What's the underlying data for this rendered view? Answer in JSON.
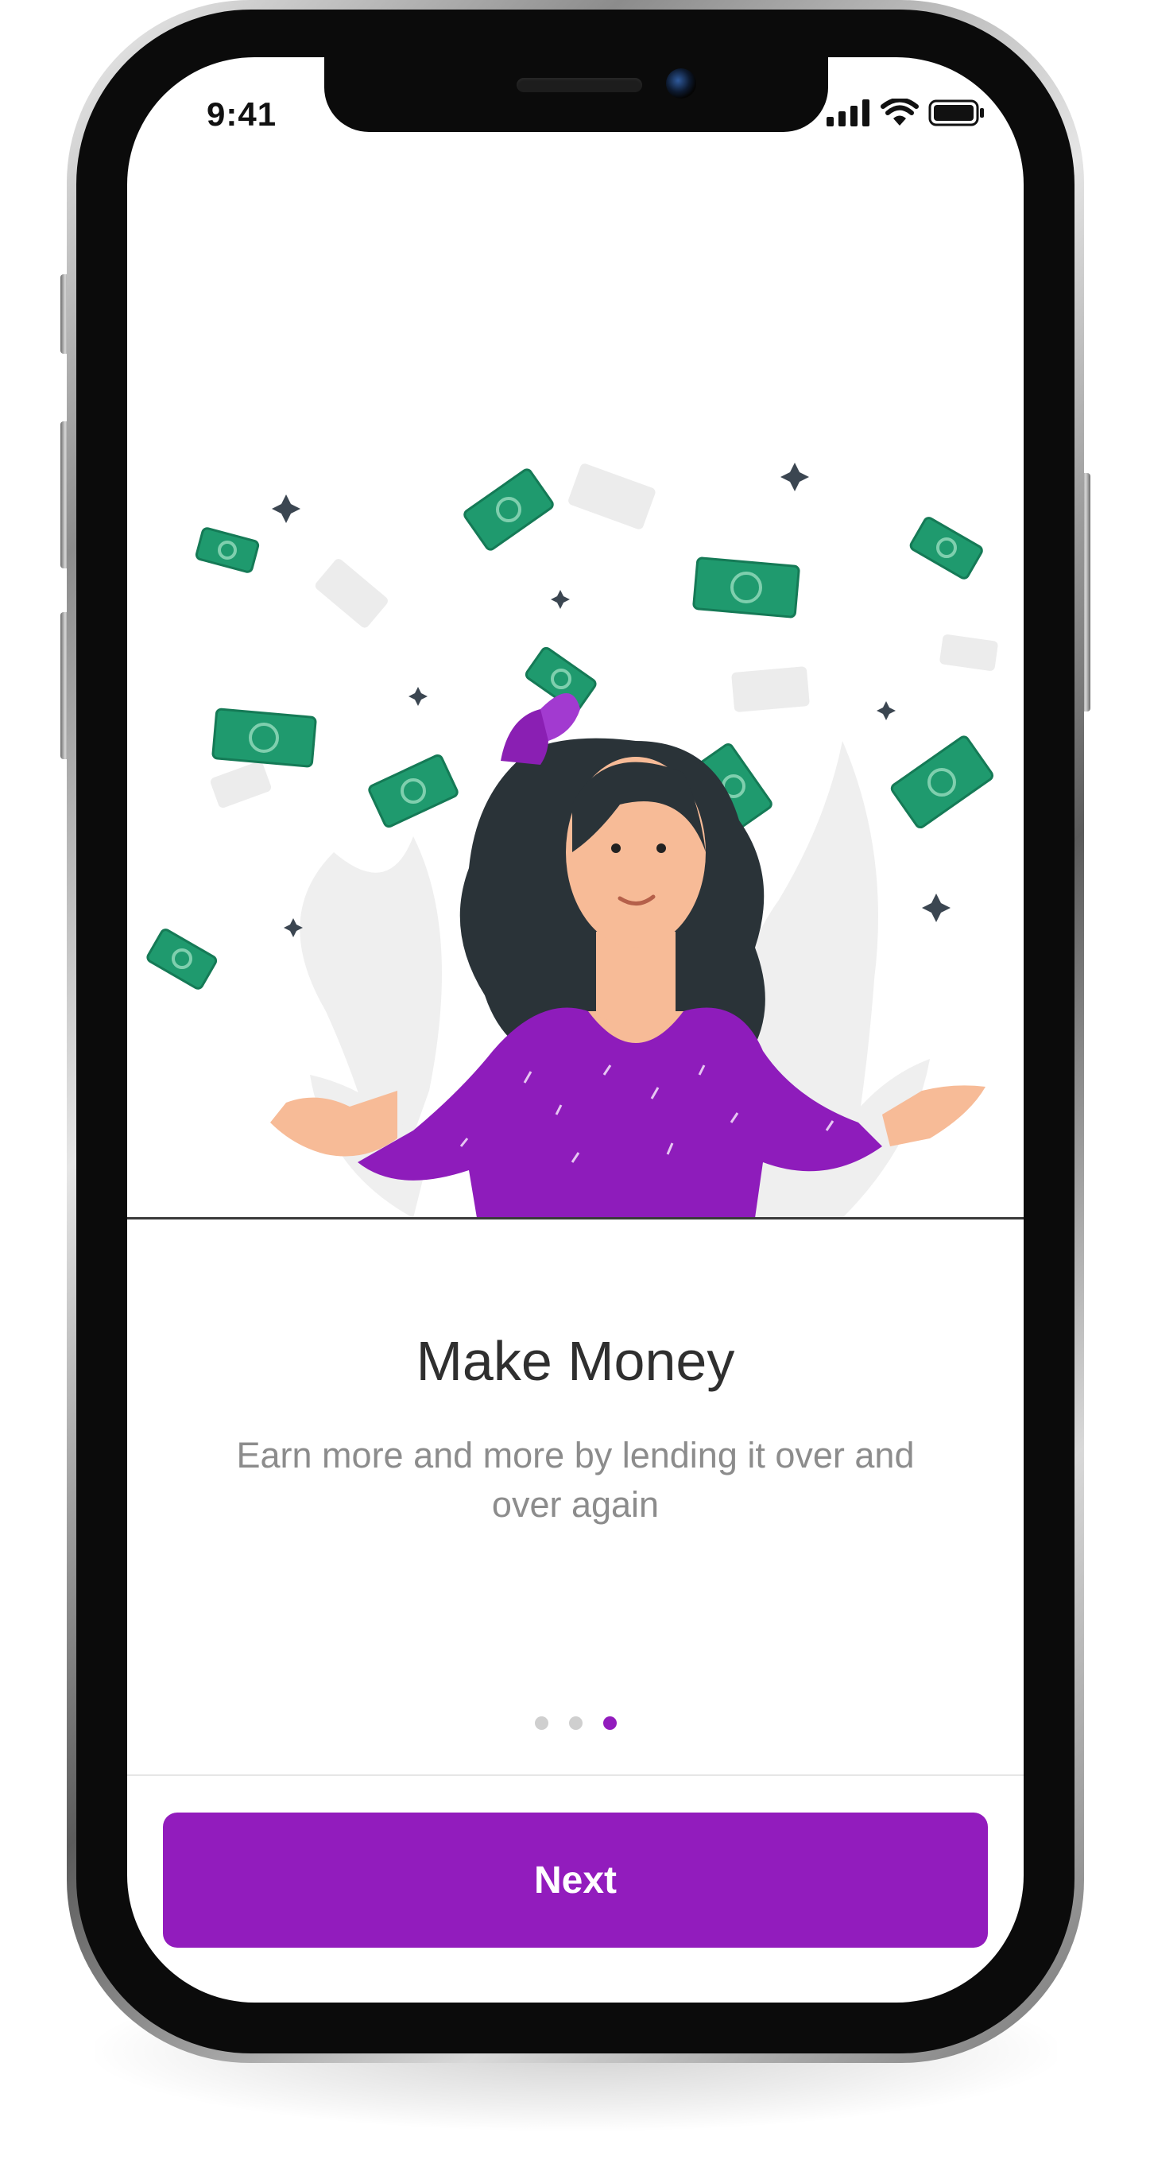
{
  "status_bar": {
    "time": "9:41"
  },
  "onboarding": {
    "title": "Make Money",
    "subtitle": "Earn more and more by lending it over and over again",
    "pagination": {
      "total": 3,
      "current": 3
    }
  },
  "footer": {
    "next_label": "Next"
  },
  "colors": {
    "accent": "#921cbd",
    "money_green": "#1f9a6e",
    "title_text": "#2f2f2f",
    "subtitle_text": "#8c8c8c",
    "dot_inactive": "#cfcfcf"
  },
  "icons": [
    "cellular-signal-icon",
    "wifi-icon",
    "battery-icon"
  ]
}
